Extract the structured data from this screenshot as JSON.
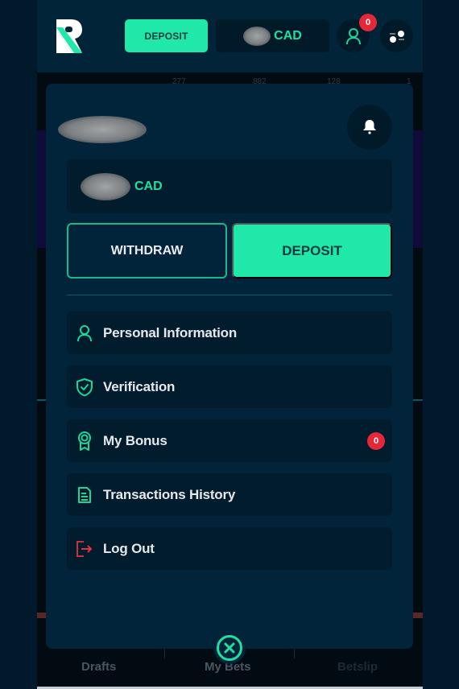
{
  "header": {
    "logo": "R-logo",
    "deposit_label": "DEPOSIT",
    "balance_currency": "CAD",
    "balance_amount_blurred": true,
    "user_icon": "user-icon",
    "notifications_count": "0",
    "settings_icon": "toggle-settings-icon"
  },
  "background": {
    "numbers": [
      "277",
      "882",
      "128",
      "1"
    ]
  },
  "panel": {
    "username_blurred": true,
    "bell_icon": "bell-icon",
    "balance": {
      "currency": "CAD",
      "amount_blurred": true
    },
    "withdraw_label": "WITHDRAW",
    "deposit_label": "DEPOSIT",
    "menu": [
      {
        "label": "Personal Information",
        "icon": "user-icon"
      },
      {
        "label": "Verification",
        "icon": "shield-check-icon"
      },
      {
        "label": "My Bonus",
        "icon": "award-icon",
        "badge": "0"
      },
      {
        "label": "Transactions History",
        "icon": "document-icon"
      },
      {
        "label": "Log Out",
        "icon": "logout-icon"
      }
    ]
  },
  "bottom_nav": {
    "items": [
      {
        "label": "Drafts"
      },
      {
        "label": "My Bets"
      },
      {
        "label": "Betslip"
      }
    ],
    "close_icon": "close-icon"
  },
  "colors": {
    "accent": "#1fe8a8",
    "panel_bg": "#02243b",
    "card_bg": "#011c2c",
    "badge_red": "#e4283a",
    "logout_red": "#c8323a"
  }
}
